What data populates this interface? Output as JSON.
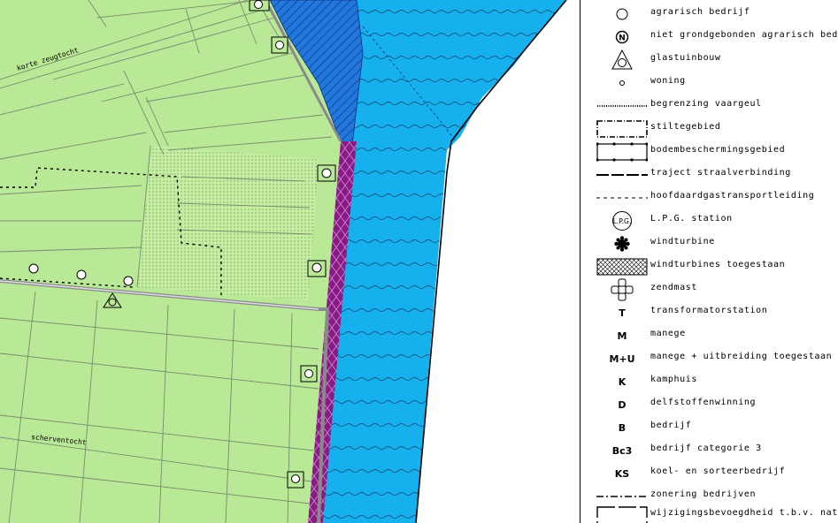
{
  "map": {
    "street_labels": [
      "korte zeugtocht",
      "scherventocht"
    ],
    "colors": {
      "agriculture": "#b9e896",
      "water": "#16b0ee",
      "canal_hatch": "#1e6fd8",
      "dyke": "#8c1a86",
      "dotted_area": "#c5eea3"
    }
  },
  "legend": {
    "items": [
      {
        "symbol": "circle-icon",
        "label": "agrarisch bedrijf"
      },
      {
        "symbol": "N-circle-icon",
        "label": "niet grondgebonden agrarisch bedrijf"
      },
      {
        "symbol": "triangle-circle-icon",
        "label": "glastuinbouw"
      },
      {
        "symbol": "small-circle-icon",
        "label": "woning"
      },
      {
        "symbol": "fairway-line-icon",
        "label": "begrenzing vaargeul"
      },
      {
        "symbol": "dashdot-box-icon",
        "label": "stiltegebied"
      },
      {
        "symbol": "dotted-box-icon",
        "label": "bodembeschermingsgebied"
      },
      {
        "symbol": "long-dash-line-icon",
        "label": "traject straalverbinding"
      },
      {
        "symbol": "dash-line-icon",
        "label": "hoofdaardgastransportleiding"
      },
      {
        "symbol": "lpg-circle-icon",
        "text": "L.P.G.",
        "label": "L.P.G. station"
      },
      {
        "symbol": "windturbine-icon",
        "label": "windturbine"
      },
      {
        "symbol": "crosshatch-box-icon",
        "label": "windturbines toegestaan"
      },
      {
        "symbol": "zendmast-icon",
        "label": "zendmast"
      },
      {
        "letter": "T",
        "label": "transformatorstation"
      },
      {
        "letter": "M",
        "label": "manege"
      },
      {
        "letter": "M+U",
        "label": "manege + uitbreiding toegestaan"
      },
      {
        "letter": "K",
        "label": "kamphuis"
      },
      {
        "letter": "D",
        "label": "delfstoffenwinning"
      },
      {
        "letter": "B",
        "label": "bedrijf"
      },
      {
        "letter": "Bc3",
        "label": "bedrijf categorie 3"
      },
      {
        "letter": "KS",
        "label": "koel- en sorteerbedrijf"
      },
      {
        "symbol": "dashdot-line-icon",
        "label": "zonering bedrijven"
      },
      {
        "symbol": "dashed-box-icon",
        "label": "wijzigingsbevoegdheid t.b.v. natuurontwikkeling"
      }
    ]
  }
}
